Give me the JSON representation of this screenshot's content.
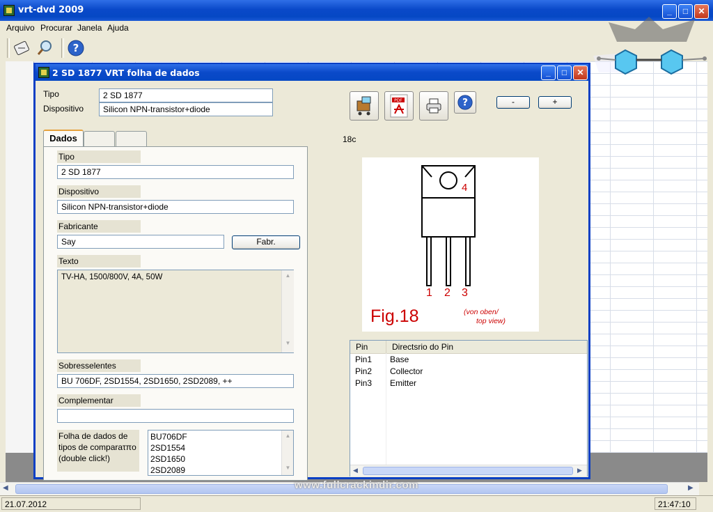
{
  "app": {
    "title": "vrt-dvd 2009"
  },
  "menu": [
    "Arquivo",
    "Procurar",
    "Janela",
    "Ajuda"
  ],
  "toolbar": {
    "icons": [
      "vrt-icon",
      "search-icon",
      "help-icon"
    ]
  },
  "statusbar": {
    "date": "21.07.2012",
    "time": "21:47:10"
  },
  "dialog": {
    "title": "2 SD 1877 VRT folha de dados",
    "header": {
      "tipo_label": "Tipo",
      "tipo_value": "2 SD 1877",
      "dispositivo_label": "Dispositivo",
      "dispositivo_value": "Silicon NPN-transistor+diode"
    },
    "tabs": [
      "Dados",
      "",
      ""
    ],
    "form": {
      "tipo_label": "Tipo",
      "tipo_value": "2 SD 1877",
      "dispositivo_label": "Dispositivo",
      "dispositivo_value": "Silicon NPN-transistor+diode",
      "fabricante_label": "Fabricante",
      "fabricante_value": "Say",
      "fabr_button": "Fabr.",
      "texto_label": "Texto",
      "texto_value": "TV-HA, 1500/800V, 4A, 50W",
      "sobresselentes_label": "Sobresselentes",
      "sobresselentes_value": "BU 706DF, 2SD1554, 2SD1650, 2SD2089, ++",
      "complementar_label": "Complementar",
      "complementar_value": "",
      "folha_label": "Folha de dados de tipos de comparaτπo (double click!)",
      "folha_list": [
        "BU706DF",
        "2SD1554",
        "2SD1650",
        "2SD2089"
      ]
    },
    "buttons": {
      "minus": "-",
      "plus": "+"
    },
    "figure_code": "18c",
    "figure": {
      "pin_labels": [
        "1",
        "2",
        "3"
      ],
      "tab_label": "4",
      "caption": "Fig.18",
      "note_line1": "(von oben/",
      "note_line2": "top view)"
    },
    "pin_table": {
      "headers": [
        "Pin",
        "Directsrio do Pin"
      ],
      "rows": [
        [
          "Pin1",
          "Base"
        ],
        [
          "Pin2",
          "Collector"
        ],
        [
          "Pin3",
          "Emitter"
        ]
      ]
    }
  },
  "watermark": "www.fullcrackindir.com"
}
